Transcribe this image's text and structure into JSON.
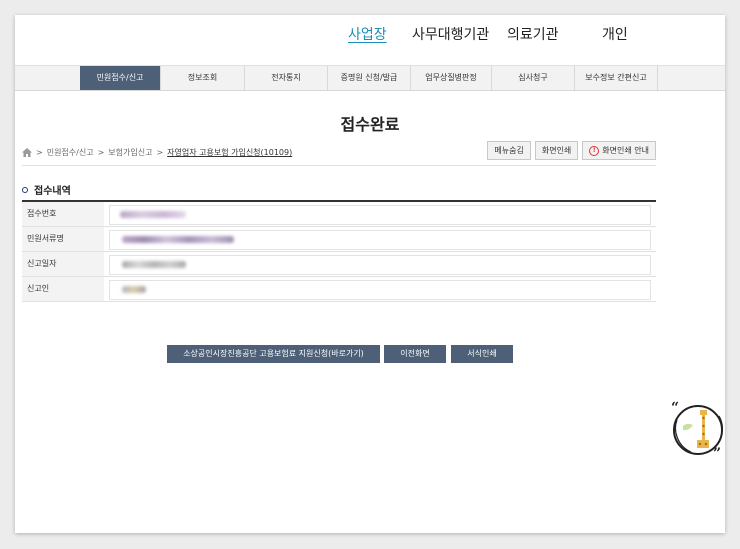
{
  "top_nav": [
    {
      "label": "사업장",
      "active": true
    },
    {
      "label": "사무대행기관",
      "active": false
    },
    {
      "label": "의료기관",
      "active": false
    },
    {
      "label": "개인",
      "active": false
    }
  ],
  "menu": [
    {
      "label": "민원접수/신고",
      "active": true
    },
    {
      "label": "정보조회",
      "active": false
    },
    {
      "label": "전자통지",
      "active": false
    },
    {
      "label": "증명원 신청/발급",
      "active": false
    },
    {
      "label": "업무상질병판정",
      "active": false
    },
    {
      "label": "심사청구",
      "active": false
    },
    {
      "label": "보수정보 간편신고",
      "active": false
    }
  ],
  "page_title": "접수완료",
  "breadcrumb": {
    "items": [
      "민원접수/신고",
      "보험가입신고"
    ],
    "current": "자영업자 고용보험 가입신청(10109)",
    "separator": ">"
  },
  "toolbar": {
    "menu_save": "메뉴숨김",
    "print_screen": "화면인쇄",
    "print_guide": "화면인쇄 안내"
  },
  "section_title": "접수내역",
  "fields": [
    {
      "label": "접수번호"
    },
    {
      "label": "민원서류명"
    },
    {
      "label": "신고일자"
    },
    {
      "label": "신고인"
    }
  ],
  "actions": {
    "support_apply": "소상공인시장진흥공단 고용보험료 지원신청(바로가기)",
    "prev_screen": "이전화면",
    "form_print": "서식인쇄"
  },
  "colors": {
    "accent": "#1a8fb8",
    "menu_active": "#4d6077",
    "button_dark": "#4d6077"
  }
}
